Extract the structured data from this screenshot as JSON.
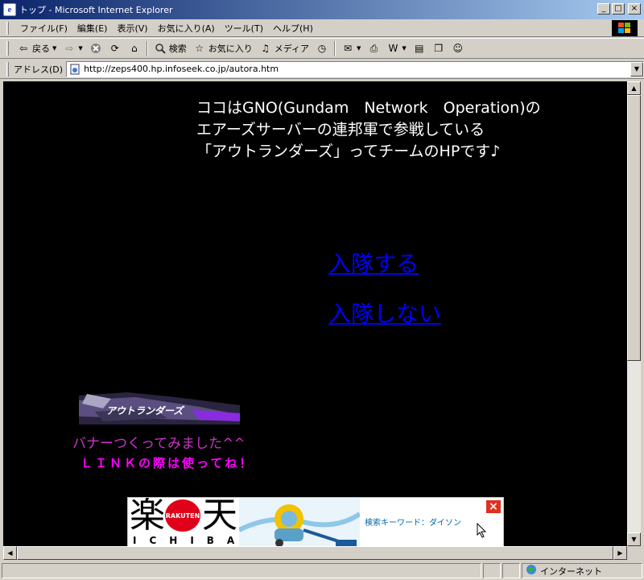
{
  "window": {
    "title": "トップ - Microsoft Internet Explorer",
    "minimize": "_",
    "maximize": "□",
    "close": "×"
  },
  "menu": {
    "items": [
      "ファイル(F)",
      "編集(E)",
      "表示(V)",
      "お気に入り(A)",
      "ツール(T)",
      "ヘルプ(H)"
    ]
  },
  "toolbar": {
    "back_label": "戻る",
    "search_label": "検索",
    "favorites_label": "お気に入り",
    "media_label": "メディア"
  },
  "address": {
    "label": "アドレス(D)",
    "url": "http://zeps400.hp.infoseek.co.jp/autora.htm"
  },
  "content": {
    "intro": [
      "ココはGNO(Gundam　Network　Operation)の",
      "エアーズサーバーの連邦軍で参戦している",
      "「アウトランダーズ」ってチームのHPです♪"
    ],
    "join_link": "入隊する",
    "nojoin_link": "入隊しない",
    "banner_text": "アウトランダーズ",
    "caption1": "バナーつくってみました^^",
    "caption2": "ＬＩＮＫの際は使ってね！"
  },
  "ad": {
    "logo_left": "楽",
    "logo_circle": "RAKUTEN",
    "logo_right": "天",
    "logo_sub": "ICHIBA",
    "keyword": "検索キーワード：ダイソン",
    "close": "×"
  },
  "status": {
    "zone": "インターネット"
  },
  "colors": {
    "link": "#0000ff",
    "caption1": "#cc33cc",
    "caption2": "#ff00ff",
    "page_bg": "#000000"
  }
}
